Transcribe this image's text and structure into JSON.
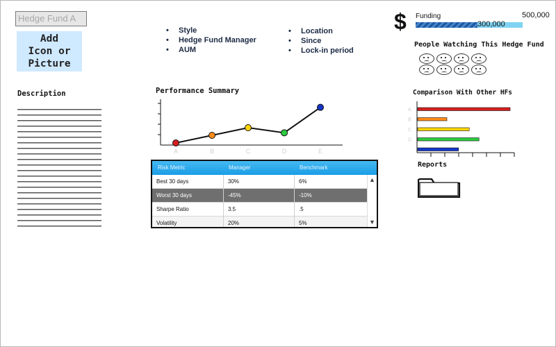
{
  "header": {
    "fund_name": "Hedge Fund A",
    "add_icon_lines": [
      "Add",
      "Icon or",
      "Picture"
    ]
  },
  "details": {
    "col1": [
      "Style",
      "Hedge Fund Manager",
      "AUM"
    ],
    "col2": [
      "Location",
      "Since",
      "Lock-in period"
    ]
  },
  "funding": {
    "symbol": "$",
    "label": "Funding",
    "max_label": "500,000",
    "current_label": "300,000",
    "progress": 0.58
  },
  "watching": {
    "title": "People Watching This Hedge Fund",
    "face_count": 8
  },
  "description": {
    "title": "Description"
  },
  "performance": {
    "title": "Performance Summary"
  },
  "chart_data": [
    {
      "type": "line",
      "title": "Performance Summary",
      "categories": [
        "A",
        "B",
        "C",
        "D",
        "E"
      ],
      "values": [
        0,
        1.5,
        3,
        2,
        7
      ],
      "point_colors": [
        "#d61f1f",
        "#ff8c1a",
        "#ffd400",
        "#2ecc40",
        "#1436c8"
      ],
      "ylim": [
        0,
        9
      ]
    },
    {
      "type": "bar",
      "orientation": "horizontal",
      "title": "Comparison With Other HFs",
      "categories": [
        "A",
        "B",
        "C",
        "D",
        ""
      ],
      "values": [
        9.5,
        3.0,
        5.3,
        6.3,
        4.2
      ],
      "bar_colors": [
        "#d61f1f",
        "#ff8c1a",
        "#ffd400",
        "#2ecc40",
        "#1436c8"
      ],
      "xlim": [
        0,
        10
      ]
    }
  ],
  "risk_table": {
    "columns": [
      "Risk Metric",
      "Manager",
      "Benchmark"
    ],
    "rows": [
      [
        "Best 30 days",
        "30%",
        "6%"
      ],
      [
        "Worst 30 days",
        "-45%",
        "-10%"
      ],
      [
        "Sharpe Ratio",
        "3.5",
        ".5"
      ],
      [
        "Volatility",
        "20%",
        "5%"
      ]
    ],
    "highlighted_row": 1
  },
  "comparison": {
    "title": "Comparison With Other HFs"
  },
  "reports": {
    "title": "Reports",
    "icon": "folder-icon"
  }
}
